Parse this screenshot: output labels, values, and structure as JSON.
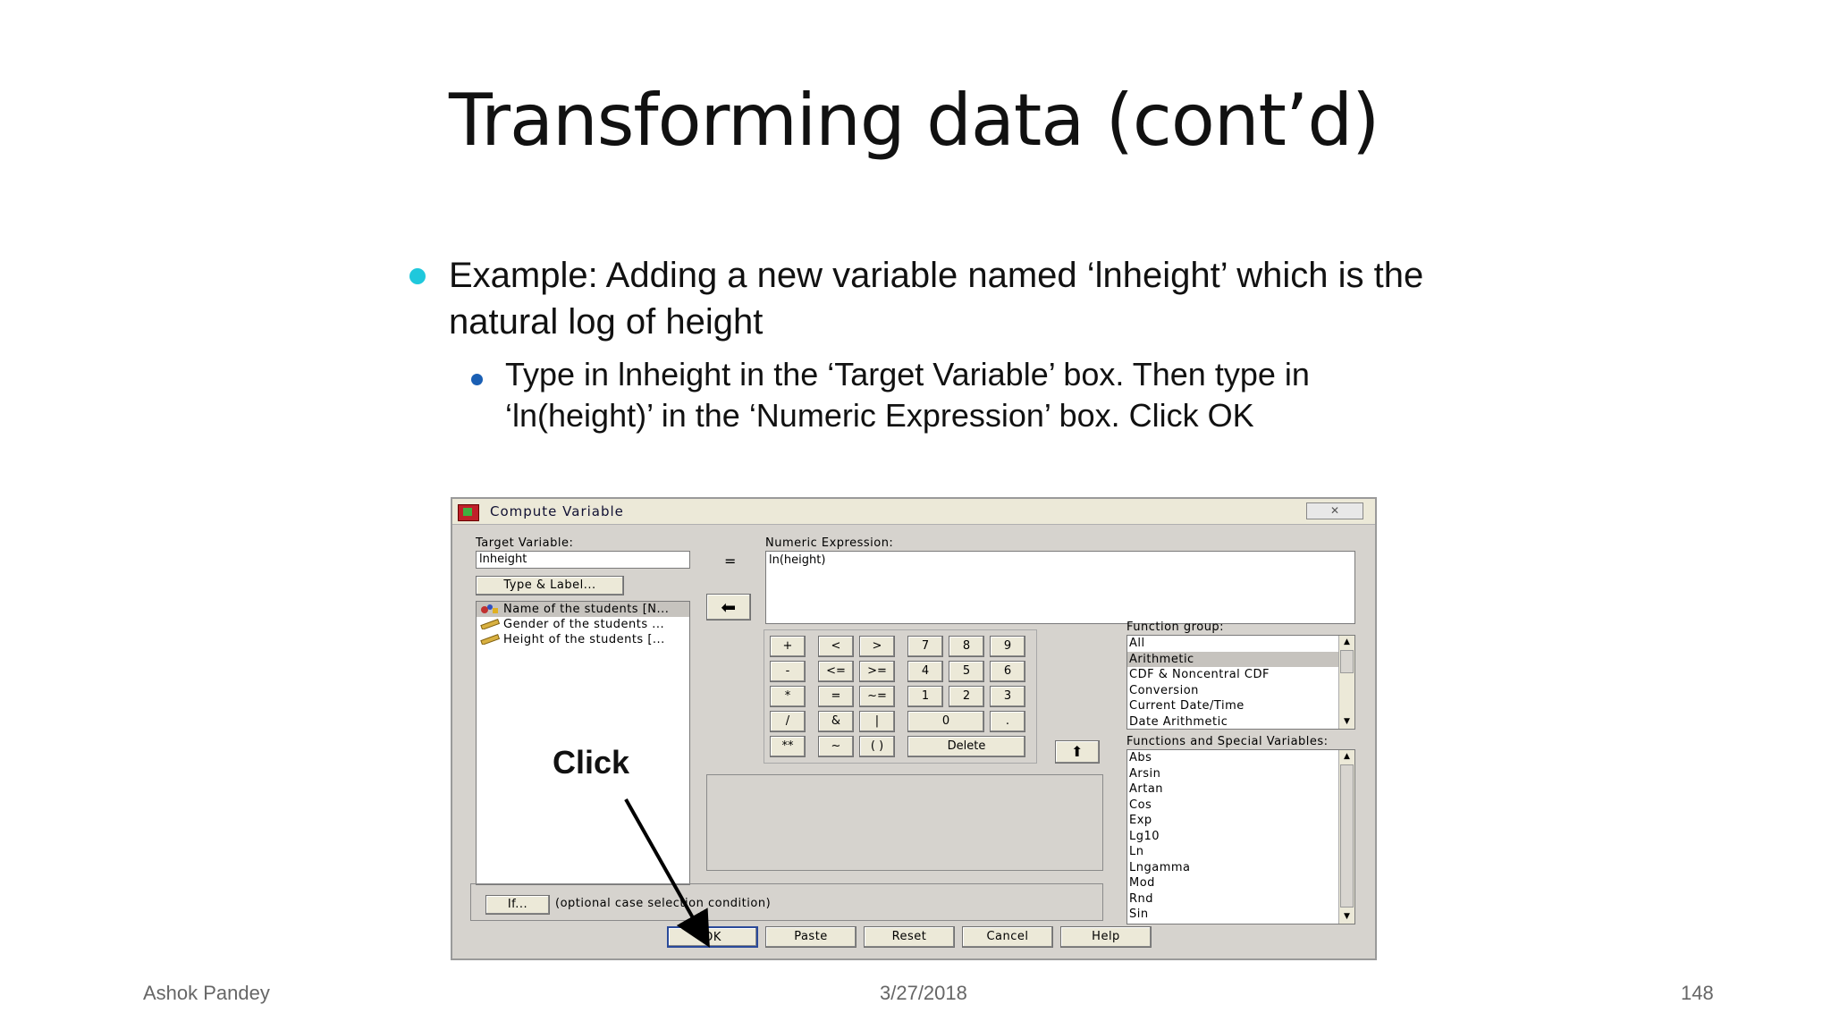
{
  "slide": {
    "title": "Transforming data (cont’d)",
    "bullet1": "Example: Adding a new variable named ‘lnheight’ which is the natural log of height",
    "bullet2": "Type in lnheight in the ‘Target Variable’ box. Then type in ‘ln(height)’ in the ‘Numeric Expression’ box. Click OK",
    "annotation": "Click",
    "footer_left": "Ashok Pandey",
    "footer_center": "3/27/2018",
    "footer_right": "148"
  },
  "dialog": {
    "title": "Compute Variable",
    "close": "✕",
    "target_label": "Target Variable:",
    "target_value": "lnheight",
    "equals": "=",
    "type_label_button": "Type & Label...",
    "variables": [
      "Name of the students [N...",
      "Gender of the students ...",
      "Height of the students [..."
    ],
    "numeric_label": "Numeric Expression:",
    "numeric_value": "ln(height)",
    "keypad": {
      "r1": [
        "+",
        "<",
        ">",
        "7",
        "8",
        "9"
      ],
      "r2": [
        "-",
        "<=",
        ">=",
        "4",
        "5",
        "6"
      ],
      "r3": [
        "*",
        "=",
        "~=",
        "1",
        "2",
        "3"
      ],
      "r4": [
        "/",
        "&",
        "|",
        "0",
        "."
      ],
      "r5": [
        "**",
        "~",
        "( )",
        "Delete"
      ]
    },
    "function_group_label": "Function group:",
    "function_groups": [
      "All",
      "Arithmetic",
      "CDF & Noncentral CDF",
      "Conversion",
      "Current Date/Time",
      "Date Arithmetic"
    ],
    "functions_label": "Functions and Special Variables:",
    "functions": [
      "Abs",
      "Arsin",
      "Artan",
      "Cos",
      "Exp",
      "Lg10",
      "Ln",
      "Lngamma",
      "Mod",
      "Rnd",
      "Sin"
    ],
    "if_button": "If...",
    "if_text": "(optional case selection condition)",
    "buttons": {
      "ok": "OK",
      "paste": "Paste",
      "reset": "Reset",
      "cancel": "Cancel",
      "help": "Help"
    }
  },
  "colors": {
    "bullet1": "#1fc8dc",
    "bullet2": "#1a5fb4",
    "dialog_bg": "#d6d3ce"
  }
}
